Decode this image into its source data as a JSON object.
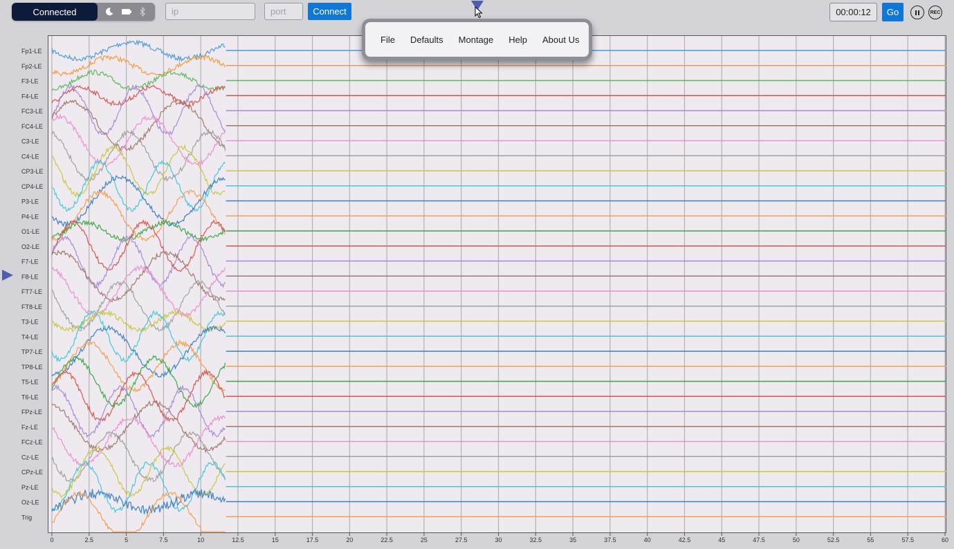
{
  "toolbar": {
    "status_label": "Connected",
    "status_icons": [
      "moon-icon",
      "battery-icon",
      "bluetooth-icon"
    ],
    "ip_placeholder": "ip",
    "port_placeholder": "port",
    "connect_label": "Connect",
    "timer": "00:00:12",
    "go_label": "Go",
    "pause_icon": "pause-icon",
    "record_label": "REC"
  },
  "menu": {
    "items": [
      "File",
      "Defaults",
      "Montage",
      "Help",
      "About Us"
    ]
  },
  "colors": {
    "accent": "#1177d6",
    "status_bg": "#0d1b3a",
    "plot_bg": "#efeaf0",
    "grid": "#aaaaaa",
    "marker": "#4f5fb0"
  },
  "chart_data": {
    "type": "line",
    "xlabel": "",
    "ylabel": "",
    "xlim": [
      0,
      60
    ],
    "x_ticks": [
      "0",
      "2.5",
      "5",
      "7.5",
      "10",
      "12.5",
      "15",
      "17.5",
      "20",
      "22.5",
      "25",
      "27.5",
      "30",
      "32.5",
      "35",
      "37.5",
      "40",
      "42.5",
      "45",
      "47.5",
      "50",
      "52.5",
      "55",
      "57.5",
      "60"
    ],
    "recorded_until_x": 11.7,
    "grid": true,
    "series": [
      {
        "name": "Fp1-LE",
        "color": "#4c9ad6"
      },
      {
        "name": "Fp2-LE",
        "color": "#f39a3c"
      },
      {
        "name": "F3-LE",
        "color": "#5cb85c"
      },
      {
        "name": "F4-LE",
        "color": "#d9534f"
      },
      {
        "name": "FC3-LE",
        "color": "#a58ad6"
      },
      {
        "name": "FC4-LE",
        "color": "#a0786a"
      },
      {
        "name": "C3-LE",
        "color": "#e98fcf"
      },
      {
        "name": "C4-LE",
        "color": "#a0a0a0"
      },
      {
        "name": "CP3-LE",
        "color": "#c8c83c"
      },
      {
        "name": "CP4-LE",
        "color": "#42c8d8"
      },
      {
        "name": "P3-LE",
        "color": "#3a7fc0"
      },
      {
        "name": "P4-LE",
        "color": "#f0a050"
      },
      {
        "name": "O1-LE",
        "color": "#3aa845"
      },
      {
        "name": "O2-LE",
        "color": "#d9534f"
      },
      {
        "name": "F7-LE",
        "color": "#a58ad6"
      },
      {
        "name": "F8-LE",
        "color": "#a0786a"
      },
      {
        "name": "FT7-LE",
        "color": "#e98fcf"
      },
      {
        "name": "FT8-LE",
        "color": "#a0a0a0"
      },
      {
        "name": "T3-LE",
        "color": "#c8c83c"
      },
      {
        "name": "T4-LE",
        "color": "#42c8d8"
      },
      {
        "name": "TP7-LE",
        "color": "#3a7fc0"
      },
      {
        "name": "TP8-LE",
        "color": "#f0a050"
      },
      {
        "name": "T5-LE",
        "color": "#3aa845"
      },
      {
        "name": "T6-LE",
        "color": "#d9534f"
      },
      {
        "name": "FPz-LE",
        "color": "#a58ad6"
      },
      {
        "name": "Fz-LE",
        "color": "#a0786a"
      },
      {
        "name": "FCz-LE",
        "color": "#e98fcf"
      },
      {
        "name": "Cz-LE",
        "color": "#a0a0a0"
      },
      {
        "name": "CPz-LE",
        "color": "#c8c83c"
      },
      {
        "name": "Pz-LE",
        "color": "#42c8d8"
      },
      {
        "name": "Oz-LE",
        "color": "#3a7fc0"
      },
      {
        "name": "Trig",
        "color": "#f0a050"
      }
    ]
  }
}
